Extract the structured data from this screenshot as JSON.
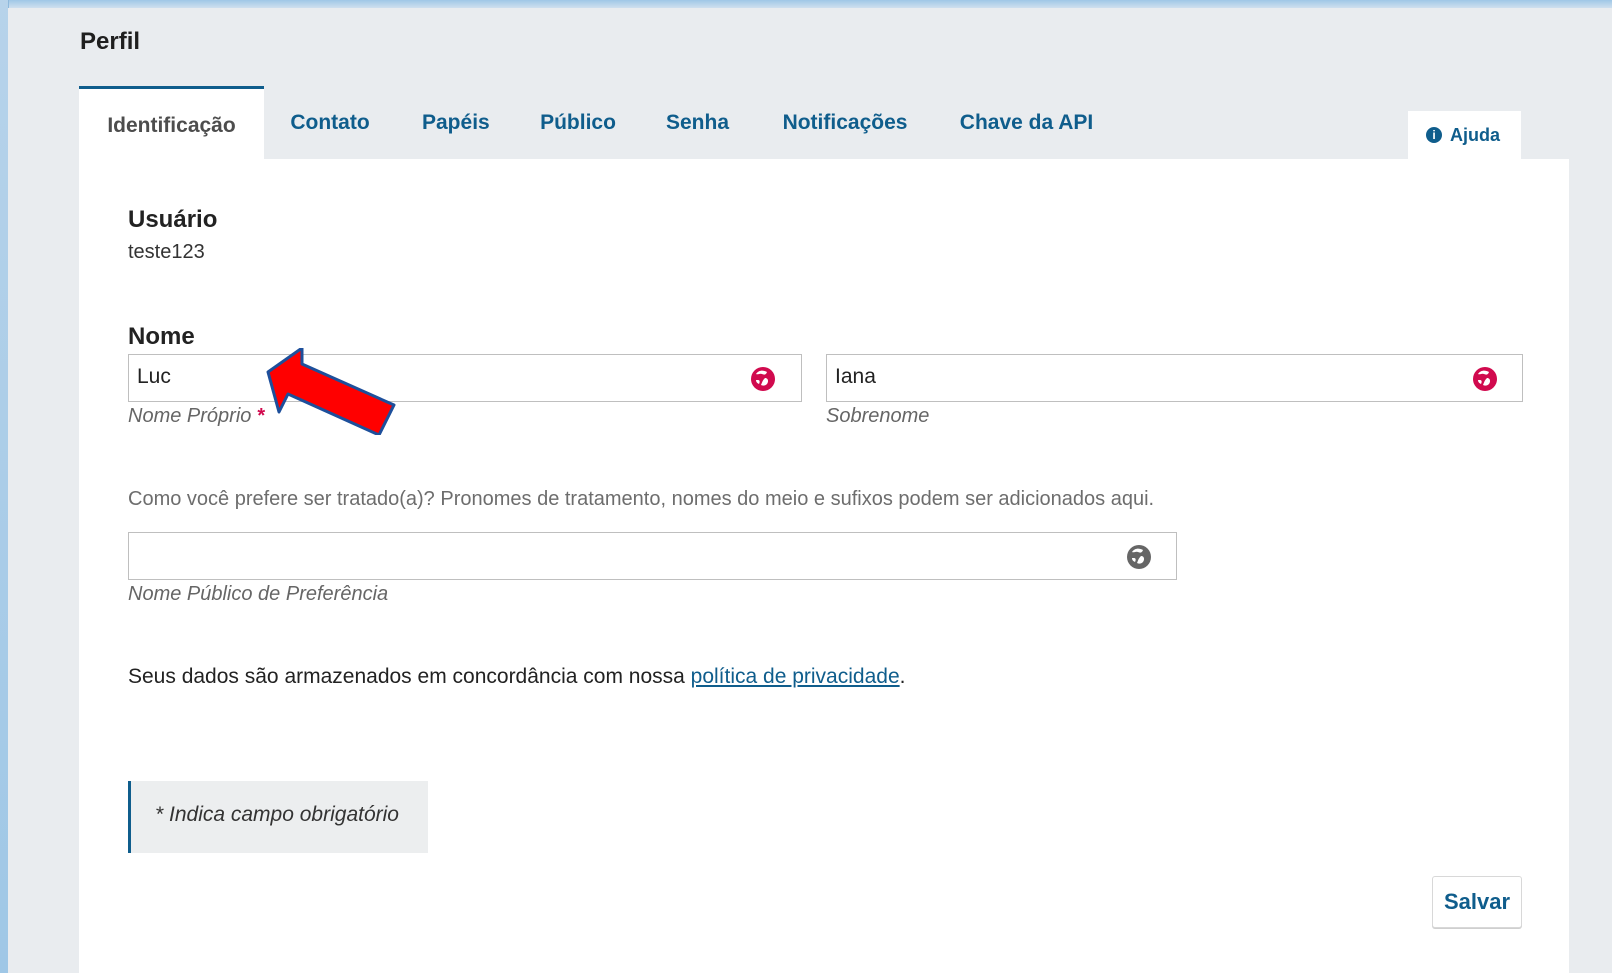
{
  "page": {
    "title": "Perfil"
  },
  "tabs": [
    {
      "label": "Identificação"
    },
    {
      "label": "Contato"
    },
    {
      "label": "Papéis"
    },
    {
      "label": "Público"
    },
    {
      "label": "Senha"
    },
    {
      "label": "Notificações"
    },
    {
      "label": "Chave da API"
    }
  ],
  "help": {
    "label": "Ajuda",
    "icon": "info-icon"
  },
  "user": {
    "label": "Usuário",
    "value": "teste123"
  },
  "name": {
    "label": "Nome",
    "first_name_value": "Luc",
    "first_name_help": "Nome Próprio",
    "first_name_required": "*",
    "last_name_value": "Iana",
    "last_name_help": "Sobrenome",
    "question": "Como você prefere ser tratado(a)? Pronomes de tratamento, nomes do meio e sufixos podem ser adicionados aqui.",
    "preferred_public_name_value": "",
    "preferred_public_name_help": "Nome Público de Preferência"
  },
  "privacy": {
    "prefix": "Seus dados são armazenados em concordância com nossa ",
    "link": "política de privacidade",
    "suffix": "."
  },
  "required_note": "* Indica campo obrigatório",
  "actions": {
    "save_label": "Salvar"
  },
  "colors": {
    "accent": "#0f5d8c",
    "required": "#d10a4e",
    "globe_active": "#d10a4e",
    "globe_inactive": "#666666",
    "arrow": "#ff0000"
  },
  "icons": {
    "globe_active": "globe-icon",
    "globe_inactive": "globe-icon",
    "pointer": "red-arrow-icon"
  }
}
